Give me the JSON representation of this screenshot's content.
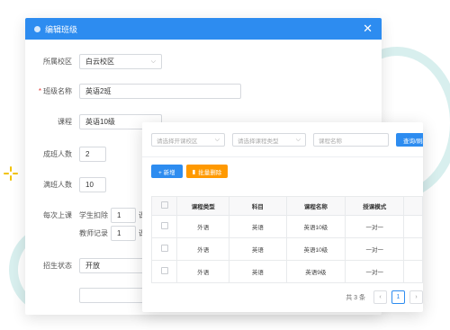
{
  "dialog": {
    "title": "编辑班级",
    "close_icon": "close-icon",
    "fields": {
      "campus": {
        "label": "所属校区",
        "value": "白云校区"
      },
      "class_name": {
        "label": "班级名称",
        "value": "英语2班"
      },
      "course": {
        "label": "课程",
        "value": "英语10级"
      },
      "min_size": {
        "label": "成班人数",
        "value": "2"
      },
      "max_size": {
        "label": "满班人数",
        "value": "10"
      },
      "per_class": {
        "label": "每次上课",
        "student_deduct_label": "学生扣除",
        "student_deduct_value": "1",
        "teacher_record_label": "教师记录",
        "teacher_record_value": "1",
        "unit": "课"
      },
      "status": {
        "label": "招生状态",
        "value": "开放"
      }
    }
  },
  "panel": {
    "filters": {
      "campus_placeholder": "请选择开课校区",
      "type_placeholder": "请选择课程类型",
      "name_placeholder": "课程名称",
      "query_label": "查询/刷新"
    },
    "toolbar": {
      "add_label": "+ 新增",
      "batch_delete_label": "批量删除"
    },
    "table": {
      "headers": [
        "课程类型",
        "科目",
        "课程名称",
        "授课模式"
      ],
      "rows": [
        [
          "外语",
          "英语",
          "英语10级",
          "一对一"
        ],
        [
          "外语",
          "英语",
          "英语10级",
          "一对一"
        ],
        [
          "外语",
          "英语",
          "英语9级",
          "一对一"
        ]
      ]
    },
    "pagination": {
      "total_text": "共 3 条",
      "prev": "‹",
      "current": "1",
      "next": "›"
    }
  },
  "colors": {
    "primary": "#2d8cf0",
    "warning": "#ff9900",
    "required": "#e53935"
  }
}
